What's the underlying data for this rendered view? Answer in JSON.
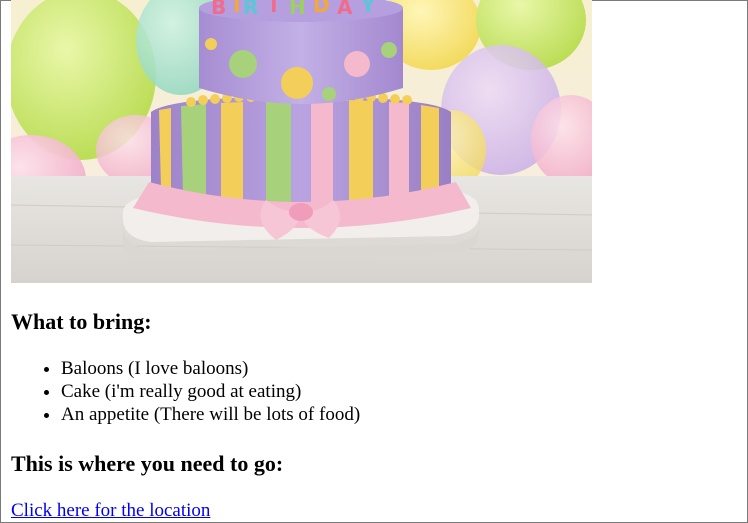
{
  "hero_image": {
    "alt": "birthday cake",
    "colors": {
      "background_top": "#f3e9c8",
      "table": "#e6e3dc",
      "cake_purple": "#a98fd0",
      "fondant_pink": "#f4b9cc",
      "stripe_yellow": "#f3cf5a",
      "stripe_green": "#a7d17a",
      "balloon_green": "#c9e86a",
      "balloon_pink": "#f6c1d6"
    }
  },
  "bring_section": {
    "heading": "What to bring:",
    "items": [
      "Baloons (I love baloons)",
      "Cake (i'm really good at eating)",
      "An appetite (There will be lots of food)"
    ]
  },
  "location_section": {
    "heading": "This is where you need to go:",
    "link_text": "Click here for the location"
  }
}
